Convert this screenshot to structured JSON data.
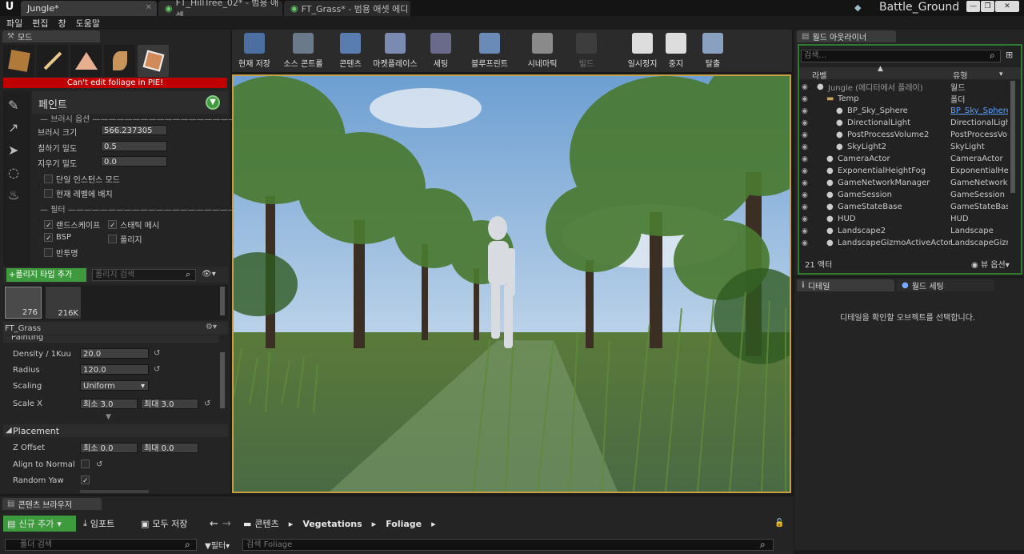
{
  "tabs": [
    {
      "label": "Jungle*",
      "active": true
    },
    {
      "label": "FT_HillTree_02* - 범용 애셋",
      "active": false
    },
    {
      "label": "FT_Grass* - 범용 애셋 에디",
      "active": false
    }
  ],
  "project_name": "Battle_Ground",
  "menu": [
    "파일",
    "편집",
    "창",
    "도움말"
  ],
  "modes": {
    "tab_label": "모드",
    "warning": "Can't edit foliage in PIE!",
    "paint_title": "페인트",
    "brush_options_header": "브러시 옵션",
    "brush_size_label": "브러시 크기",
    "brush_size_value": "566.237305",
    "paint_density_label": "칠하기 밀도",
    "paint_density_value": "0.5",
    "erase_density_label": "지우기 밀도",
    "erase_density_value": "0.0",
    "single_instance_label": "단일 인스턴스 모드",
    "place_current_level_label": "현재 레벨에 배치",
    "filter_header": "필터",
    "filters": [
      {
        "label": "랜드스케이프",
        "checked": true
      },
      {
        "label": "스태틱 메시",
        "checked": true
      },
      {
        "label": "BSP",
        "checked": true
      },
      {
        "label": "폴리지",
        "checked": false
      },
      {
        "label": "반투명",
        "checked": false
      }
    ],
    "add_foliage_label": "+폴리지 타입 추가",
    "foliage_search_placeholder": "폴리지 검색",
    "thumb1_count": "276",
    "thumb2_count": "216K",
    "selected_type": "FT_Grass",
    "painting_section": "Painting",
    "density_label": "Density / 1Kuu",
    "density_value": "20.0",
    "radius_label": "Radius",
    "radius_value": "120.0",
    "scaling_label": "Scaling",
    "scaling_value": "Uniform",
    "scalex_label": "Scale X",
    "scalex_min_label": "최소",
    "scalex_min": "3.0",
    "scalex_max_label": "최대",
    "scalex_max": "3.0",
    "placement_section": "Placement",
    "zoffset_label": "Z Offset",
    "zoffset_min_label": "최소",
    "zoffset_min": "0.0",
    "zoffset_max_label": "최대",
    "zoffset_max": "0.0",
    "align_normal_label": "Align to Normal",
    "random_yaw_label": "Random Yaw"
  },
  "toolbar": [
    {
      "label": "현재 저장",
      "icon": "save-icon"
    },
    {
      "label": "소스 콘트롤",
      "icon": "source-control-icon"
    },
    {
      "label": "콘텐츠",
      "icon": "content-icon"
    },
    {
      "label": "마켓플레이스",
      "icon": "marketplace-icon"
    },
    {
      "label": "세팅",
      "icon": "settings-icon"
    },
    {
      "label": "블루프린트",
      "icon": "blueprint-icon"
    },
    {
      "label": "시네마틱",
      "icon": "cinematic-icon"
    },
    {
      "label": "빌드",
      "icon": "build-icon"
    },
    {
      "label": "일시정지",
      "icon": "pause-icon"
    },
    {
      "label": "중지",
      "icon": "stop-icon"
    },
    {
      "label": "탈출",
      "icon": "eject-icon"
    }
  ],
  "outliner": {
    "tab_label": "월드 아웃라이너",
    "search_placeholder": "검색...",
    "col_label": "라벨",
    "col_type": "유형",
    "rows": [
      {
        "name": "Jungle (에디터에서 플레이)",
        "type": "월드",
        "indent": 0
      },
      {
        "name": "Temp",
        "type": "폴더",
        "indent": 1
      },
      {
        "name": "BP_Sky_Sphere",
        "type": "BP_Sky_Sphere",
        "indent": 2,
        "link": true
      },
      {
        "name": "DirectionalLight",
        "type": "DirectionalLigh",
        "indent": 2
      },
      {
        "name": "PostProcessVolume2",
        "type": "PostProcessVo",
        "indent": 2
      },
      {
        "name": "SkyLight2",
        "type": "SkyLight",
        "indent": 2
      },
      {
        "name": "CameraActor",
        "type": "CameraActor",
        "indent": 1
      },
      {
        "name": "ExponentialHeightFog",
        "type": "ExponentialHei",
        "indent": 1
      },
      {
        "name": "GameNetworkManager",
        "type": "GameNetworkM",
        "indent": 1
      },
      {
        "name": "GameSession",
        "type": "GameSession",
        "indent": 1
      },
      {
        "name": "GameStateBase",
        "type": "GameStateBase",
        "indent": 1
      },
      {
        "name": "HUD",
        "type": "HUD",
        "indent": 1
      },
      {
        "name": "Landscape2",
        "type": "Landscape",
        "indent": 1
      },
      {
        "name": "LandscapeGizmoActiveActor",
        "type": "LandscapeGizm",
        "indent": 1
      }
    ],
    "actor_count": "21 액터",
    "view_options": "뷰 옵션"
  },
  "details": {
    "tab_label": "디테일",
    "world_settings_tab": "월드 세팅",
    "empty_message": "디테일을 확인할 오브젝트를 선택합니다."
  },
  "content_browser": {
    "tab_label": "콘텐츠 브라우저",
    "add_new": "신규 추가",
    "import": "임포트",
    "save_all": "모두 저장",
    "path": [
      "콘텐츠",
      "Vegetations",
      "Foliage"
    ],
    "folder_search_placeholder": "폴더 검색",
    "filter_label": "필터",
    "search_placeholder": "검색 Foliage"
  },
  "colors": {
    "accent_green": "#3d9b3d",
    "viewport_border": "#c8a043",
    "warning_red": "#c00000"
  }
}
